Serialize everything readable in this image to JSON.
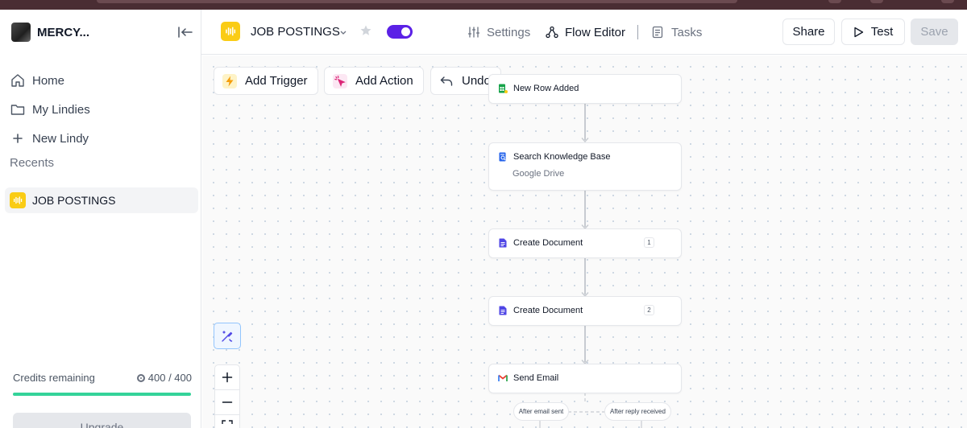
{
  "sidebar": {
    "workspace_name": "MERCY...",
    "nav": [
      {
        "label": "Home",
        "icon": "home-icon"
      },
      {
        "label": "My Lindies",
        "icon": "folder-icon"
      },
      {
        "label": "New Lindy",
        "icon": "plus-icon"
      }
    ],
    "recents_label": "Recents",
    "recents": [
      {
        "label": "JOB POSTINGS",
        "icon": "waveform-icon"
      }
    ],
    "credits": {
      "label": "Credits remaining",
      "value": "400 / 400",
      "fraction": 1.0
    },
    "upgrade_label": "Upgrade"
  },
  "header": {
    "project_title": "JOB POSTINGS",
    "toggle_on": true,
    "nav": [
      {
        "label": "Settings",
        "icon": "sliders-icon",
        "active": false
      },
      {
        "label": "Flow Editor",
        "icon": "flow-icon",
        "active": true
      },
      {
        "label": "Tasks",
        "icon": "document-icon",
        "active": false
      }
    ],
    "share_label": "Share",
    "test_label": "Test",
    "save_label": "Save"
  },
  "toolbar": {
    "add_trigger": "Add Trigger",
    "add_action": "Add Action",
    "undo": "Undo"
  },
  "flow": {
    "nodes": [
      {
        "title": "New Row Added",
        "icon": "sheets-icon"
      },
      {
        "title": "Search Knowledge Base",
        "subtitle": "Google Drive",
        "icon": "knowledge-base-icon"
      },
      {
        "title": "Create Document",
        "badge": "1",
        "icon": "docs-icon"
      },
      {
        "title": "Create Document",
        "badge": "2",
        "icon": "docs-icon"
      },
      {
        "title": "Send Email",
        "icon": "gmail-icon"
      }
    ],
    "branches": [
      "After email sent",
      "After reply received"
    ]
  },
  "colors": {
    "accent": "#5b21e6",
    "brand_yellow": "#facc15",
    "progress": "#34d399"
  }
}
